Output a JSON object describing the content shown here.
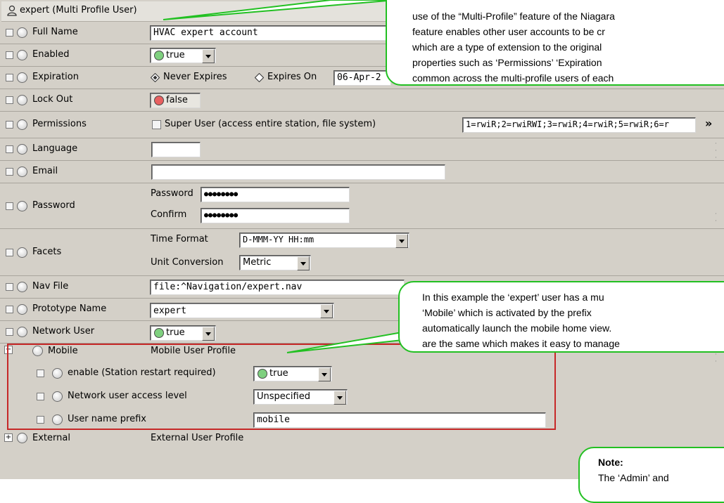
{
  "header": {
    "user": "expert",
    "title": "expert  (Multi Profile User)"
  },
  "rows": {
    "full_name": {
      "label": "Full Name",
      "value": "HVAC expert account"
    },
    "enabled": {
      "label": "Enabled",
      "value": "true"
    },
    "expiration": {
      "label": "Expiration",
      "never": "Never Expires",
      "on": "Expires On",
      "date": "06-Apr-2"
    },
    "lock_out": {
      "label": "Lock Out",
      "value": "false"
    },
    "permissions": {
      "label": "Permissions",
      "super": "Super User (access entire station, file system)",
      "value": "1=rwiR;2=rwiRWI;3=rwiR;4=rwiR;5=rwiR;6=r",
      "more": "»"
    },
    "language": {
      "label": "Language",
      "value": ""
    },
    "email": {
      "label": "Email",
      "value": ""
    },
    "password": {
      "label": "Password",
      "pw_label": "Password",
      "pw_value": "●●●●●●●●",
      "confirm_label": "Confirm",
      "confirm_value": "●●●●●●●●"
    },
    "facets": {
      "label": "Facets",
      "time_label": "Time Format",
      "time_value": "D-MMM-YY HH:mm",
      "unit_label": "Unit Conversion",
      "unit_value": "Metric"
    },
    "nav_file": {
      "label": "Nav File",
      "value": "file:^Navigation/expert.nav"
    },
    "prototype": {
      "label": "Prototype Name",
      "value": "expert"
    },
    "network_user": {
      "label": "Network User",
      "value": "true"
    },
    "mobile": {
      "label": "Mobile",
      "desc": "Mobile User Profile",
      "toggle": "−"
    },
    "enable": {
      "label": "enable (Station restart required)",
      "value": "true"
    },
    "net_access": {
      "label": "Network user access level",
      "value": "Unspecified"
    },
    "prefix": {
      "label": "User name prefix",
      "value": "mobile"
    },
    "external": {
      "label": "External",
      "desc": "External User Profile",
      "toggle": "+"
    }
  },
  "callouts": {
    "top": [
      "use of the “Multi-Profile” feature of the Niagara",
      "feature enables other user accounts to be cr",
      "which are a type of extension to the original",
      "properties such as ‘Permissions’ ‘Expiration",
      "common across the multi-profile users of each"
    ],
    "mid": [
      "In this example the ‘expert’ user has a mu",
      "‘Mobile’ which is activated by the prefix",
      "automatically launch the mobile home view.",
      "are the same which makes it easy to manage"
    ],
    "note_title": "Note:",
    "note_body": "The ‘Admin’ and"
  },
  "colors": {
    "accent_green": "#22c022",
    "highlight_red": "#c62828",
    "true_green": "#7fd07f",
    "false_red": "#e86060"
  }
}
